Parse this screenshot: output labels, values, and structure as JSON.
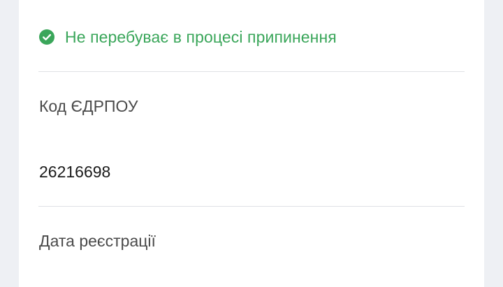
{
  "status": {
    "icon": "check-circle-icon",
    "text": "Не перебуває в процесі припинення",
    "color": "#3aa65a"
  },
  "fields": [
    {
      "label": "Код ЄДРПОУ",
      "value": "26216698"
    },
    {
      "label": "Дата реєстрації"
    }
  ]
}
